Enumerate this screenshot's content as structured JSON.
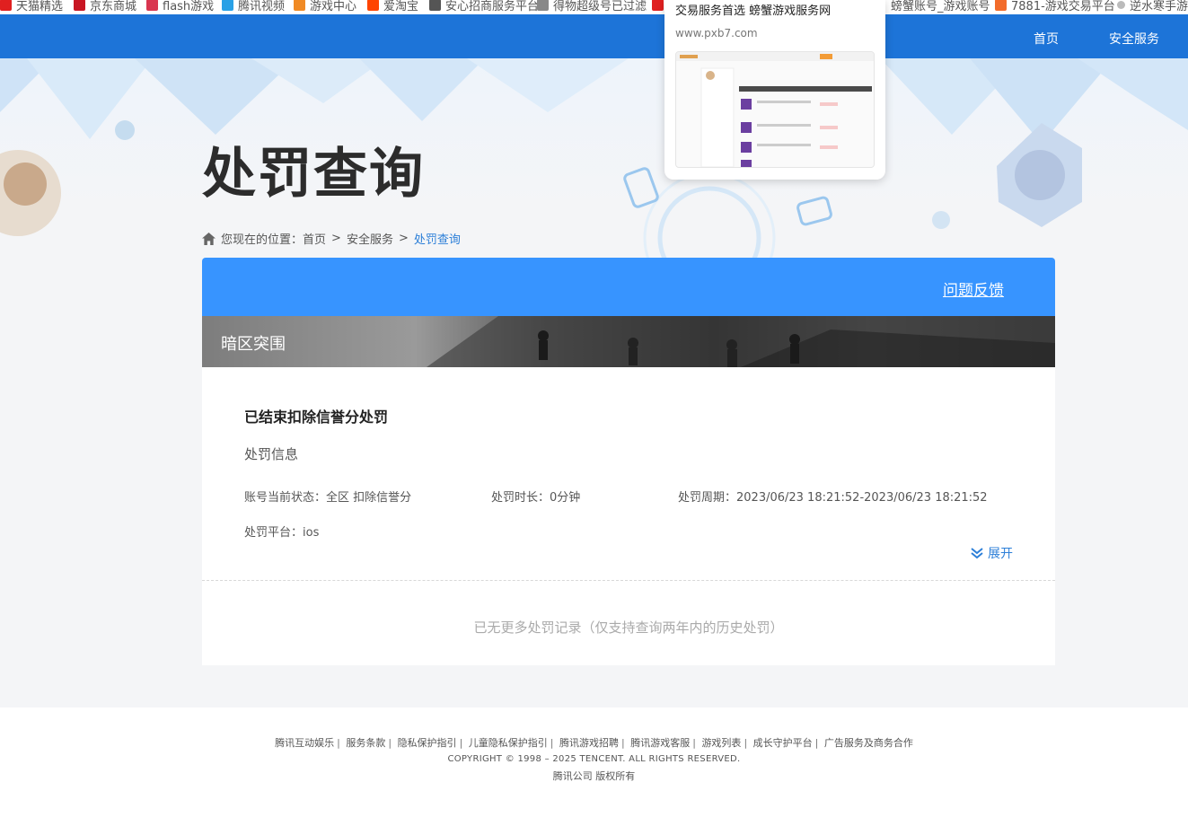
{
  "bookmarks": [
    {
      "label": "天猫精选",
      "color": "#e02020"
    },
    {
      "label": "京东商城",
      "color": "#c81623"
    },
    {
      "label": "flash游戏",
      "color": "#d9364f"
    },
    {
      "label": "腾讯视频",
      "color": "#2aa1e6"
    },
    {
      "label": "游戏中心",
      "color": "#f08a24"
    },
    {
      "label": "爱淘宝",
      "color": "#ff4400"
    },
    {
      "label": "安心招商服务平台",
      "color": "#555555"
    },
    {
      "label": "得物超级号已过滤",
      "color": "#888888"
    },
    {
      "label": "",
      "color": "#e02020"
    },
    {
      "label": "螃蟹账号_游戏账号",
      "color": "#888888"
    },
    {
      "label": "7881-游戏交易平台",
      "color": "#f26b2a"
    },
    {
      "label": "逆水寒手游",
      "color": "#888888"
    }
  ],
  "nav": {
    "home": "首页",
    "security": "安全服务"
  },
  "tooltip": {
    "title": "交易服务首选 螃蟹游戏服务网",
    "url": "www.pxb7.com"
  },
  "page": {
    "title": "处罚查询"
  },
  "breadcrumb": {
    "prefix": "您现在的位置：",
    "home": "首页",
    "security": "安全服务",
    "current": "处罚查询",
    "sep": ">"
  },
  "panel": {
    "feedback": "问题反馈",
    "game_name": "暗区突围",
    "status_title": "已结束扣除信誉分处罚",
    "info_label": "处罚信息",
    "account_status": "账号当前状态：全区 扣除信誉分",
    "duration": "处罚时长：0分钟",
    "period": "处罚周期：2023/06/23 18:21:52-2023/06/23 18:21:52",
    "platform": "处罚平台：ios",
    "expand": "展开",
    "no_more": "已无更多处罚记录（仅支持查询两年内的历史处罚）"
  },
  "footer": {
    "links": [
      "腾讯互动娱乐",
      "服务条款",
      "隐私保护指引",
      "儿童隐私保护指引",
      "腾讯游戏招聘",
      "腾讯游戏客服",
      "游戏列表",
      "成长守护平台",
      "广告服务及商务合作"
    ],
    "pipe": "|",
    "copyright": "COPYRIGHT © 1998 – 2025 TENCENT. ALL RIGHTS RESERVED.",
    "company": "腾讯公司 版权所有"
  },
  "colors": {
    "nav_bg": "#1d74d8",
    "panel_head": "#3794ff",
    "link_blue": "#2c7fd8"
  }
}
